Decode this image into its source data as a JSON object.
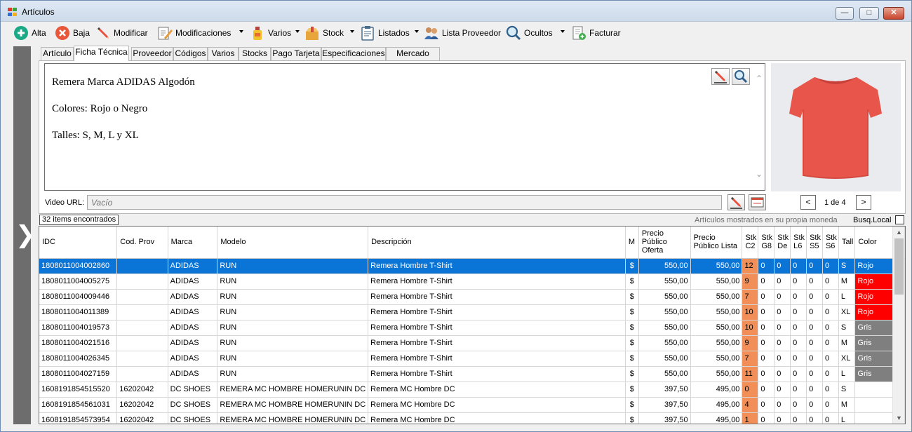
{
  "window": {
    "title": "Artículos"
  },
  "toolbar": {
    "alta": "Alta",
    "baja": "Baja",
    "modificar": "Modificar",
    "modificaciones": "Modificaciones",
    "varios": "Varios",
    "stock": "Stock",
    "listados": "Listados",
    "lista_proveedor": "Lista Proveedor",
    "ocultos": "Ocultos",
    "facturar": "Facturar"
  },
  "tabs": [
    "Artículo",
    "Ficha Técnica",
    "Proveedor",
    "Códigos",
    "Varios",
    "Stocks",
    "Pago Tarjeta",
    "Especificaciones",
    "Mercado Libre"
  ],
  "active_tab": "Ficha Técnica",
  "ficha": {
    "line1": "Remera Marca ADIDAS Algodón",
    "line2": "Colores: Rojo o Negro",
    "line3": "Talles: S, M, L y XL"
  },
  "video": {
    "label": "Video URL:",
    "placeholder": "Vacío"
  },
  "pager": {
    "prev": "<",
    "next": ">",
    "text": "1 de 4"
  },
  "status": {
    "count": "32 items encontrados",
    "moneda": "Artículos mostrados en su propia moneda",
    "busq_local": "Busq.Local"
  },
  "grid": {
    "headers": [
      "IDC",
      "Cod. Prov",
      "Marca",
      "Modelo",
      "Descripción",
      "M",
      "Precio Público Oferta",
      "Precio Público Lista",
      "Stk C2",
      "Stk G8",
      "Stk De",
      "Stk L6",
      "Stk S5",
      "Stk S6",
      "Tall",
      "Color"
    ],
    "rows": [
      {
        "idc": "1808011004002860",
        "cod": "",
        "marca": "ADIDAS",
        "modelo": "RUN",
        "desc": "Remera Hombre T-Shirt",
        "m": "$",
        "oferta": "550,00",
        "lista": "550,00",
        "s1": "12",
        "s2": "0",
        "s3": "0",
        "s4": "0",
        "s5": "0",
        "s6": "0",
        "tall": "S",
        "color": "Rojo",
        "selected": true
      },
      {
        "idc": "1808011004005275",
        "cod": "",
        "marca": "ADIDAS",
        "modelo": "RUN",
        "desc": "Remera Hombre T-Shirt",
        "m": "$",
        "oferta": "550,00",
        "lista": "550,00",
        "s1": "9",
        "s2": "0",
        "s3": "0",
        "s4": "0",
        "s5": "0",
        "s6": "0",
        "tall": "M",
        "color": "Rojo"
      },
      {
        "idc": "1808011004009446",
        "cod": "",
        "marca": "ADIDAS",
        "modelo": "RUN",
        "desc": "Remera Hombre T-Shirt",
        "m": "$",
        "oferta": "550,00",
        "lista": "550,00",
        "s1": "7",
        "s2": "0",
        "s3": "0",
        "s4": "0",
        "s5": "0",
        "s6": "0",
        "tall": "L",
        "color": "Rojo"
      },
      {
        "idc": "1808011004011389",
        "cod": "",
        "marca": "ADIDAS",
        "modelo": "RUN",
        "desc": "Remera Hombre T-Shirt",
        "m": "$",
        "oferta": "550,00",
        "lista": "550,00",
        "s1": "10",
        "s2": "0",
        "s3": "0",
        "s4": "0",
        "s5": "0",
        "s6": "0",
        "tall": "XL",
        "color": "Rojo"
      },
      {
        "idc": "1808011004019573",
        "cod": "",
        "marca": "ADIDAS",
        "modelo": "RUN",
        "desc": "Remera Hombre T-Shirt",
        "m": "$",
        "oferta": "550,00",
        "lista": "550,00",
        "s1": "10",
        "s2": "0",
        "s3": "0",
        "s4": "0",
        "s5": "0",
        "s6": "0",
        "tall": "S",
        "color": "Gris"
      },
      {
        "idc": "1808011004021516",
        "cod": "",
        "marca": "ADIDAS",
        "modelo": "RUN",
        "desc": "Remera Hombre T-Shirt",
        "m": "$",
        "oferta": "550,00",
        "lista": "550,00",
        "s1": "9",
        "s2": "0",
        "s3": "0",
        "s4": "0",
        "s5": "0",
        "s6": "0",
        "tall": "M",
        "color": "Gris"
      },
      {
        "idc": "1808011004026345",
        "cod": "",
        "marca": "ADIDAS",
        "modelo": "RUN",
        "desc": "Remera Hombre T-Shirt",
        "m": "$",
        "oferta": "550,00",
        "lista": "550,00",
        "s1": "7",
        "s2": "0",
        "s3": "0",
        "s4": "0",
        "s5": "0",
        "s6": "0",
        "tall": "XL",
        "color": "Gris"
      },
      {
        "idc": "1808011004027159",
        "cod": "",
        "marca": "ADIDAS",
        "modelo": "RUN",
        "desc": "Remera Hombre T-Shirt",
        "m": "$",
        "oferta": "550,00",
        "lista": "550,00",
        "s1": "11",
        "s2": "0",
        "s3": "0",
        "s4": "0",
        "s5": "0",
        "s6": "0",
        "tall": "L",
        "color": "Gris"
      },
      {
        "idc": "1608191854515520",
        "cod": "16202042",
        "marca": "DC SHOES",
        "modelo": "REMERA MC HOMBRE HOMERUNIN DC",
        "desc": "Remera MC Hombre DC",
        "m": "$",
        "oferta": "397,50",
        "lista": "495,00",
        "s1": "0",
        "s2": "0",
        "s3": "0",
        "s4": "0",
        "s5": "0",
        "s6": "0",
        "tall": "S",
        "color": ""
      },
      {
        "idc": "1608191854561031",
        "cod": "16202042",
        "marca": "DC SHOES",
        "modelo": "REMERA MC HOMBRE HOMERUNIN DC",
        "desc": "Remera MC Hombre DC",
        "m": "$",
        "oferta": "397,50",
        "lista": "495,00",
        "s1": "4",
        "s2": "0",
        "s3": "0",
        "s4": "0",
        "s5": "0",
        "s6": "0",
        "tall": "M",
        "color": ""
      },
      {
        "idc": "1608191854573954",
        "cod": "16202042",
        "marca": "DC SHOES",
        "modelo": "REMERA MC HOMBRE HOMERUNIN DC",
        "desc": "Remera MC Hombre DC",
        "m": "$",
        "oferta": "397,50",
        "lista": "495,00",
        "s1": "1",
        "s2": "0",
        "s3": "0",
        "s4": "0",
        "s5": "0",
        "s6": "0",
        "tall": "L",
        "color": ""
      }
    ]
  },
  "colors": {
    "selection": "#0a74d7",
    "stock_cell": "#f28f58",
    "rojo": "#ff0000",
    "gris": "#7f7f7f",
    "sidebar": "#6d6d6d"
  },
  "icons": {
    "app": "app-grid-icon",
    "alta": "plus-circle-icon",
    "baja": "x-circle-icon",
    "modificar": "pencil-icon",
    "modificaciones": "edit-document-icon",
    "varios": "bottle-icon",
    "stock": "box-icon",
    "listados": "clipboard-icon",
    "lista_proveedor": "users-icon",
    "ocultos": "magnifier-icon",
    "facturar": "invoice-icon"
  }
}
